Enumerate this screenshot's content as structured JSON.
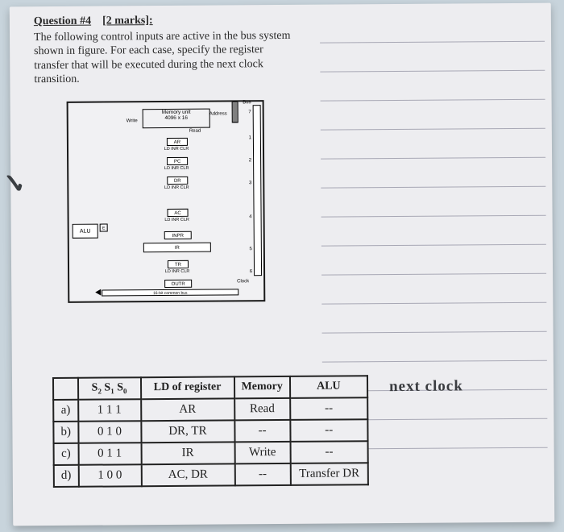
{
  "question": {
    "number_label": "Question #4",
    "marks_label": "[2 marks]:",
    "body": "The following control inputs are active in the bus system shown in figure. For each case, specify the register transfer that will be executed during the next clock transition."
  },
  "diagram": {
    "memory_line1": "Memory unit",
    "memory_line2": "4096 x 16",
    "address": "Address",
    "write": "Write",
    "read": "Read",
    "bus": "Bus",
    "clock": "Clock",
    "alu": "ALU",
    "e": "E",
    "ctrl_lbl": "LD INR CLR",
    "bottom_bus": "16-bit common bus",
    "regs": {
      "ar": "AR",
      "pc": "PC",
      "dr": "DR",
      "ac": "AC",
      "inpr": "INPR",
      "ir": "IR",
      "tr": "TR",
      "outr": "OUTR"
    },
    "nums": [
      "7",
      "1",
      "2",
      "3",
      "4",
      "5",
      "6"
    ]
  },
  "table": {
    "headers": {
      "select": "S₂ S₁ S₀",
      "ld": "LD of register",
      "memory": "Memory",
      "alu": "ALU"
    },
    "rows": [
      {
        "letter": "a)",
        "sel": "1 1 1",
        "ld": "AR",
        "mem": "Read",
        "alu": "--"
      },
      {
        "letter": "b)",
        "sel": "0 1 0",
        "ld": "DR, TR",
        "mem": "--",
        "alu": "--"
      },
      {
        "letter": "c)",
        "sel": "0 1 1",
        "ld": "IR",
        "mem": "Write",
        "alu": "--"
      },
      {
        "letter": "d)",
        "sel": "1 0 0",
        "ld": "AC, DR",
        "mem": "--",
        "alu": "Transfer DR"
      }
    ]
  },
  "handwriting": "next clock"
}
